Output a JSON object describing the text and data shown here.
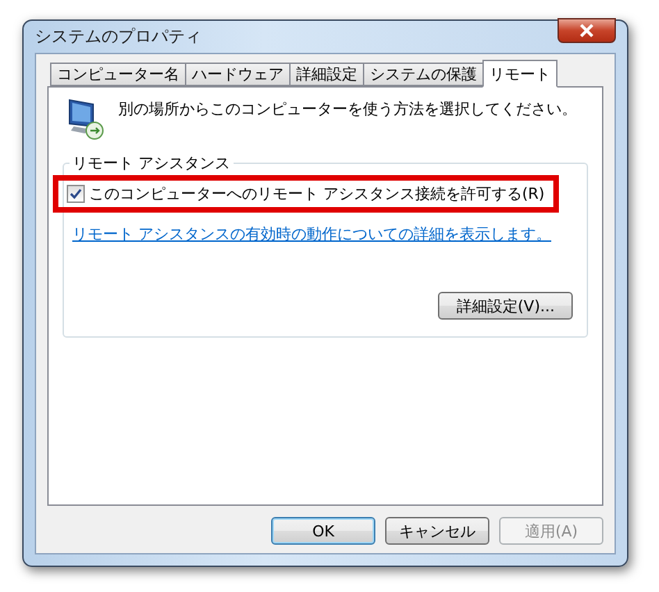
{
  "window": {
    "title": "システムのプロパティ"
  },
  "tabs": [
    {
      "label": "コンピューター名",
      "selected": false
    },
    {
      "label": "ハードウェア",
      "selected": false
    },
    {
      "label": "詳細設定",
      "selected": false
    },
    {
      "label": "システムの保護",
      "selected": false
    },
    {
      "label": "リモート",
      "selected": true
    }
  ],
  "intro": "別の場所からこのコンピューターを使う方法を選択してください。",
  "remote_assistance": {
    "legend": "リモート アシスタンス",
    "checkbox": {
      "label": "このコンピューターへのリモート アシスタンス接続を許可する(R)",
      "checked": true,
      "highlighted": true
    },
    "link": "リモート アシスタンスの有効時の動作についての詳細を表示します。",
    "advanced_button": "詳細設定(V)..."
  },
  "buttons": [
    {
      "label": "OK",
      "default": true,
      "disabled": false
    },
    {
      "label": "キャンセル",
      "default": false,
      "disabled": false
    },
    {
      "label": "適用(A)",
      "default": false,
      "disabled": true
    }
  ]
}
